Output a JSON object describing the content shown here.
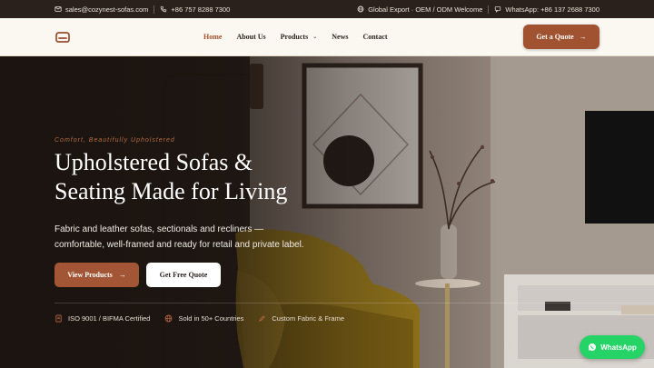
{
  "topbar": {
    "email": "sales@cozynest-sofas.com",
    "phone": "+86 757 8288 7300",
    "global": "Global Export · OEM / ODM Welcome",
    "whatsapp": "WhatsApp: +86 137 2688 7300"
  },
  "nav": {
    "logo_icon": "sofa-icon",
    "items": [
      {
        "label": "Home",
        "active": true
      },
      {
        "label": "About Us"
      },
      {
        "label": "Products",
        "has_dropdown": true
      },
      {
        "label": "News"
      },
      {
        "label": "Contact"
      }
    ],
    "cta": "Get a Quote"
  },
  "hero": {
    "kicker": "Comfort, Beautifully Upholstered",
    "headline_line1": "Upholstered Sofas &",
    "headline_line2": "Seating Made for Living",
    "subtext_line1": "Fabric and leather sofas, sectionals and recliners —",
    "subtext_line2": "comfortable, well-framed and ready for retail and private label.",
    "primary_button": "View Products",
    "secondary_button": "Get Free Quote"
  },
  "features": [
    {
      "icon": "certificate-icon",
      "label": "ISO 9001 / BIFMA Certified"
    },
    {
      "icon": "globe-icon",
      "label": "Sold in 50+ Countries"
    },
    {
      "icon": "pen-icon",
      "label": "Custom Fabric & Frame"
    }
  ],
  "whatsapp_button": "WhatsApp",
  "colors": {
    "accent": "#a35635",
    "topbar_bg": "#2a211c",
    "nav_bg": "#fbf7f1",
    "whatsapp": "#25d366"
  }
}
